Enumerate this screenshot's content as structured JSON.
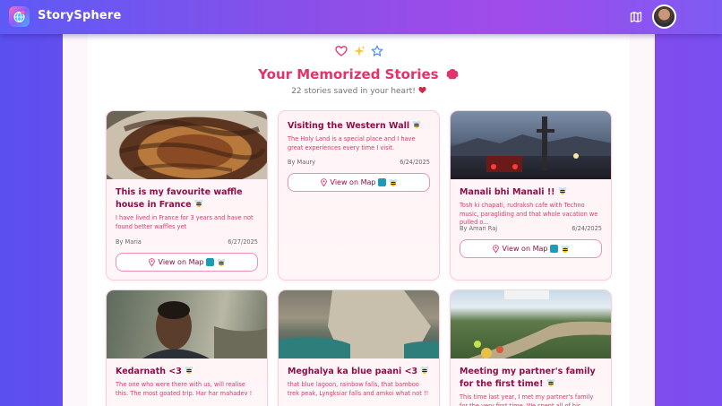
{
  "app": {
    "name": "StorySphere"
  },
  "header": {
    "title": "Your Memorized Stories",
    "subtitle": "22 stories saved in your heart!"
  },
  "colors": {
    "accent": "#e3336b",
    "title_dark": "#8a1147",
    "desc": "#d8396e",
    "border": "#f6cfdc"
  },
  "icons": [
    "heart-icon",
    "sparkles-icon",
    "star-icon",
    "map-icon",
    "pin-icon",
    "brain-icon",
    "bee-icon"
  ],
  "cards": [
    {
      "title": "This is my favourite waffle house in France",
      "description": "I have lived in France for 3 years and have not found better waffles yet",
      "author": "By Maria",
      "date": "6/27/2025",
      "map_label": "View on Map",
      "has_image": true
    },
    {
      "title": "Visiting the Western Wall",
      "description": "The Holy Land is a special place and I have great experiences every time I visit.",
      "author": "By Maury",
      "date": "6/24/2025",
      "map_label": "View on Map",
      "has_image": false
    },
    {
      "title": "Manali bhi Manali !!",
      "description": "Tosh ki chapati, rudraksh cafe with Techno music, paragliding and that whole vacation we pulled o...",
      "author": "By Aman Raj",
      "date": "6/24/2025",
      "map_label": "View on Map",
      "has_image": true
    },
    {
      "title": "Kedarnath <3",
      "description": "The one who were there with us, will realise this. The most goated trip. Har har mahadev !",
      "has_image": true
    },
    {
      "title": "Meghalya ka blue paani <3",
      "description": "that blue lagoon, rainbow falls, that bamboo trek peak, Lyngksiar falls and amkoi what not !!",
      "has_image": true
    },
    {
      "title": "Meeting my partner's family for the first time!",
      "description": "This time last year, I met my partner's family for the very first time. We spent all of his summers...",
      "has_image": true
    }
  ]
}
